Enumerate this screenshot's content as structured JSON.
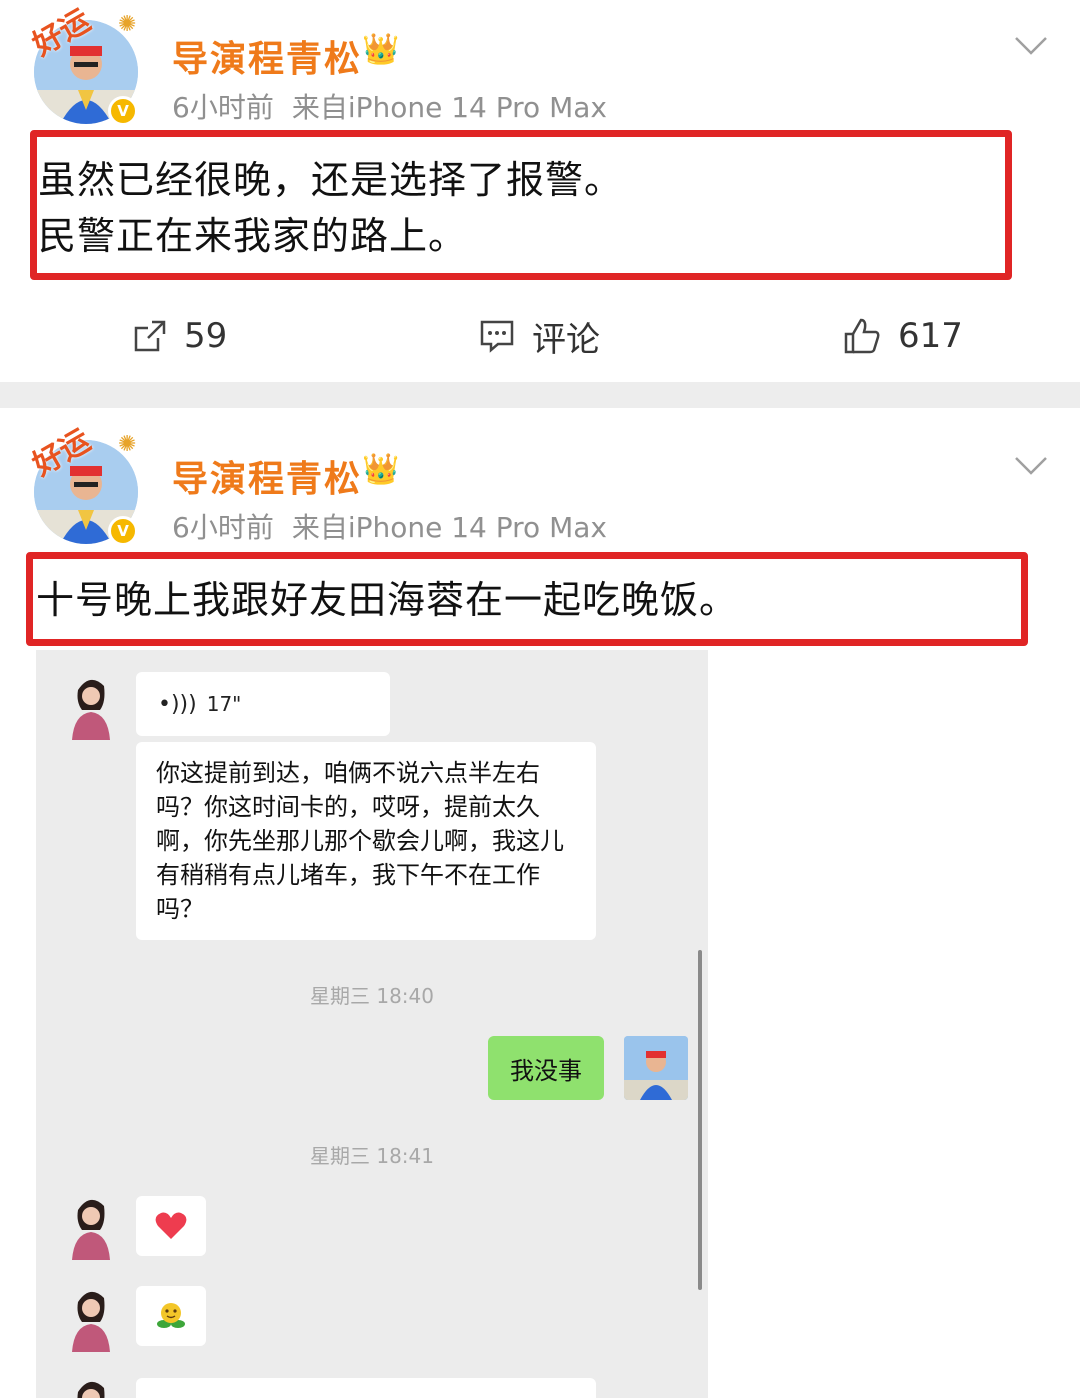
{
  "posts": [
    {
      "author": "导演程青松",
      "time": "6小时前",
      "source": "来自iPhone 14 Pro Max",
      "text_lines": [
        "虽然已经很晚，还是选择了报警。",
        "民警正在来我家的路上。"
      ],
      "avatar_sticker": "好运",
      "actions": {
        "repost_count": "59",
        "comment_label": "评论",
        "like_count": "617"
      }
    },
    {
      "author": "导演程青松",
      "time": "6小时前",
      "source": "来自iPhone 14 Pro Max",
      "text_lines": [
        "十号晚上我跟好友田海蓉在一起吃晚饭。"
      ],
      "avatar_sticker": "好运"
    }
  ],
  "chat": {
    "voice_duration": "17\"",
    "long_message": "你这提前到达，咱俩不说六点半左右吗？你这时间卡的，哎呀，提前太久啊，你先坐那儿那个歇会儿啊，我这儿有稍稍有点儿堵车，我下午不在工作吗？",
    "timestamp_1": "星期三 18:40",
    "my_reply": "我没事",
    "timestamp_2": "星期三 18:41"
  },
  "colors": {
    "accent_name": "#ef7a1a",
    "highlight_box": "#e02525",
    "chat_bg": "#ececec",
    "my_bubble": "#8fe16e"
  },
  "icons": [
    "verified-badge-icon",
    "crown-icon",
    "chevron-down-icon",
    "repost-icon",
    "comment-icon",
    "like-icon",
    "voice-wave-icon",
    "heart-emoji-icon",
    "flower-emoji-icon"
  ]
}
